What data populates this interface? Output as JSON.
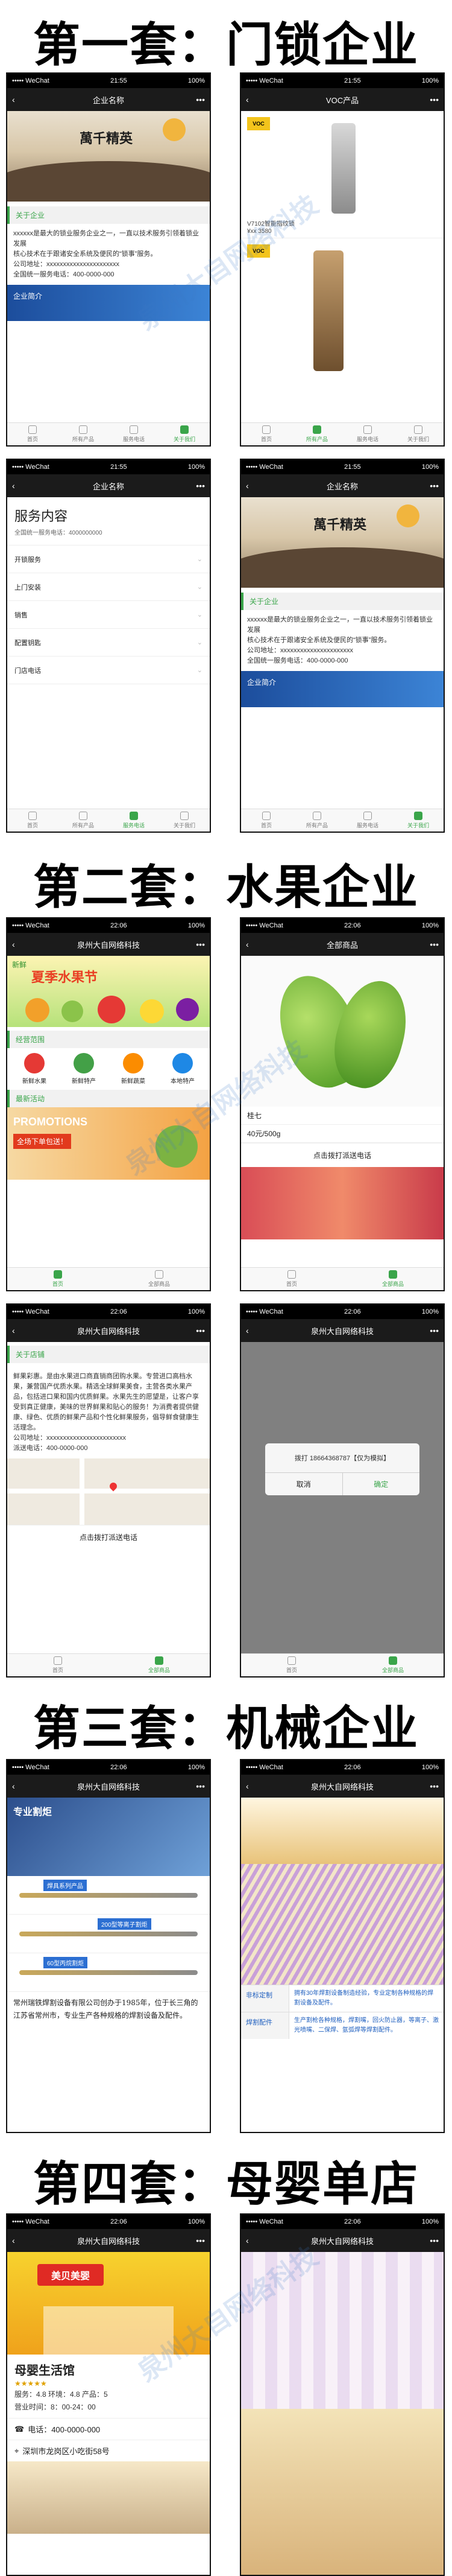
{
  "sections": {
    "s1": "第一套：门锁企业",
    "s2": "第二套：水果企业",
    "s3": "第三套：机械企业",
    "s4": "第四套：母婴单店"
  },
  "common": {
    "carrier": "••••• WeChat",
    "wifi": "◠",
    "time": "21:55",
    "time2": "22:06",
    "battery": "100%",
    "back": "‹",
    "more": "•••"
  },
  "watermark": "泉州大自网络科技",
  "phone1": {
    "title": "企业名称",
    "banner_text": "萬千精英",
    "section": "关于企业",
    "para": "xxxxxx是最大的锁业服务企业之一，一直以技术服务引领着锁业发展\n核心技术在于跟诸安全系统及便民的“锁事”服务。\n公司地址：xxxxxxxxxxxxxxxxxxxxxx\n全国统一服务电话：400-0000-000",
    "promo": "企业简介",
    "tabs": [
      "首页",
      "所有产品",
      "服务电话",
      "关于我们"
    ]
  },
  "phone2": {
    "title": "VOC产品",
    "logo": "VOC",
    "caption1": "V7102智能指纹锁",
    "caption2": "¥xx 3580",
    "tabs": [
      "首页",
      "所有产品",
      "服务电话",
      "关于我们"
    ]
  },
  "phone3": {
    "title": "企业名称",
    "heading": "服务内容",
    "sub": "全国统一服务电话：4000000000",
    "items": [
      "开锁服务",
      "上门安装",
      "销售",
      "配置钥匙",
      "门店电话"
    ],
    "tabs": [
      "首页",
      "所有产品",
      "服务电话",
      "关于我们"
    ]
  },
  "phone4": {
    "title": "企业名称",
    "banner_text": "萬千精英",
    "section": "关于企业",
    "para": "xxxxxx是最大的锁业服务企业之一，一直以技术服务引领着锁业发展\n核心技术在于跟诸安全系统及便民的“锁事”服务。\n公司地址：xxxxxxxxxxxxxxxxxxxxxx\n全国统一服务电话：400-0000-000",
    "promo": "企业简介",
    "tabs": [
      "首页",
      "所有产品",
      "服务电话",
      "关于我们"
    ]
  },
  "phone5": {
    "title": "泉州大自网络科技",
    "banner_text": "夏季水果节",
    "banner_small": "新鲜",
    "section1": "经营范围",
    "cats": [
      "新鲜水果",
      "新鲜特产",
      "新鲜蔬菜",
      "本地特产"
    ],
    "section2": "最新活动",
    "promo_title": "PROMOTIONS",
    "promo_sub": "全场下单包送！",
    "tabs": [
      "首页",
      "全部商品"
    ]
  },
  "phone6": {
    "title": "全部商品",
    "product": "桂七",
    "price": "40元/500g",
    "call": "点击拨打派送电话",
    "tabs": [
      "首页",
      "全部商品"
    ]
  },
  "phone7": {
    "title": "泉州大自网络科技",
    "section": "关于店铺",
    "para": "鲜果彩惠。是由水果进口商直销商团购水果。专营进口高档水果，兼营国产优质水果。精选全球鲜果美食，主营各类水果产品，包括进口果和国内优质鲜果。水果先生的愿望是，让客户享受到真正健康，美味的世界鲜果和贴心的服务！为消费者提供健康、绿色、优质的鲜果产品和个性化鲜果服务，倡导鲜食健康生活理念。\n公司地址：xxxxxxxxxxxxxxxxxxxxxxxx\n派送电话：400-0000-000",
    "call": "点击拨打派送电话",
    "tabs": [
      "首页",
      "全部商品"
    ]
  },
  "phone8": {
    "title": "泉州大自网络科技",
    "dialog_msg": "拨打 18664368787【仅为模拟】",
    "cancel": "取消",
    "ok": "确定",
    "tabs": [
      "首页",
      "全部商品"
    ]
  },
  "phone9": {
    "title": "泉州大自网络科技",
    "banner": "专业割炬",
    "labels": [
      "焊具系列产品",
      "200型等离子割炬",
      "60型丙烷割炬"
    ],
    "para": "常州瑞铁焊割设备有限公司创办于1985年，位于长三角的江苏省常州市，专业生产各种规格的焊割设备及配件。"
  },
  "phone10": {
    "title": "泉州大自网络科技",
    "rows": [
      {
        "label": "非标定制",
        "text": "拥有30年焊割设备制造经验，专业定制各种规格的焊割设备及配件。"
      },
      {
        "label": "焊割配件",
        "text": "生产割枪各种规格，焊割嘴，回火防止器，等离子、激光喷嘴、二保焊、氩弧焊等焊割配件。"
      }
    ]
  },
  "phone11": {
    "title": "泉州大自网络科技",
    "sign": "美贝美婴",
    "shop": "母婴生活馆",
    "stars": "★★★★★",
    "score": "服务：4.8 环境：4.8 产品：5",
    "hours": "营业时间：8：00-24：00",
    "phone": "电话：400-0000-000",
    "address": "深圳市龙岗区小吃街58号"
  },
  "phone12": {
    "title": "泉州大自网络科技"
  }
}
